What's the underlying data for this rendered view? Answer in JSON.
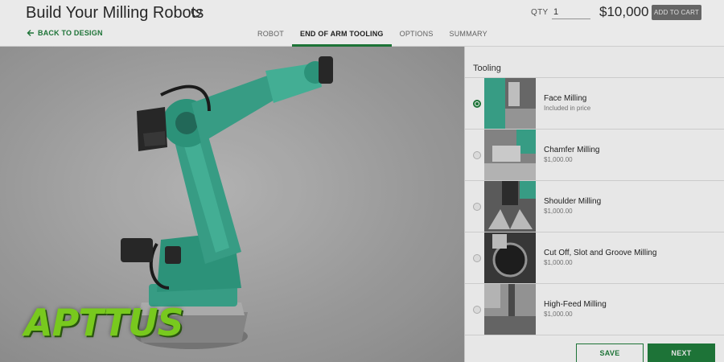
{
  "header": {
    "title": "Build Your Milling Robots",
    "favorite_icon": "heart-outline-icon",
    "qty_label": "QTY",
    "qty_value": "1",
    "price": "$10,000",
    "add_to_cart": "ADD TO CART",
    "back_label": "BACK TO DESIGN",
    "back_icon": "arrow-left-icon"
  },
  "tabs": [
    {
      "label": "ROBOT",
      "active": false
    },
    {
      "label": "END OF ARM TOOLING",
      "active": true
    },
    {
      "label": "OPTIONS",
      "active": false
    },
    {
      "label": "SUMMARY",
      "active": false
    }
  ],
  "stage": {
    "logo_text": "APTTUS"
  },
  "panel": {
    "title": "Tooling",
    "options": [
      {
        "name": "Face Milling",
        "price": "Included in price",
        "selected": true
      },
      {
        "name": "Chamfer Milling",
        "price": "$1,000.00",
        "selected": false
      },
      {
        "name": "Shoulder Milling",
        "price": "$1,000.00",
        "selected": false
      },
      {
        "name": "Cut Off, Slot and Groove Milling",
        "price": "$1,000.00",
        "selected": false
      },
      {
        "name": "High-Feed Milling",
        "price": "$1,000.00",
        "selected": false
      }
    ],
    "save_label": "SAVE",
    "next_label": "NEXT"
  },
  "colors": {
    "accent": "#1f7a3a",
    "robot": "#3aa58c",
    "logo": "#7fd420"
  }
}
